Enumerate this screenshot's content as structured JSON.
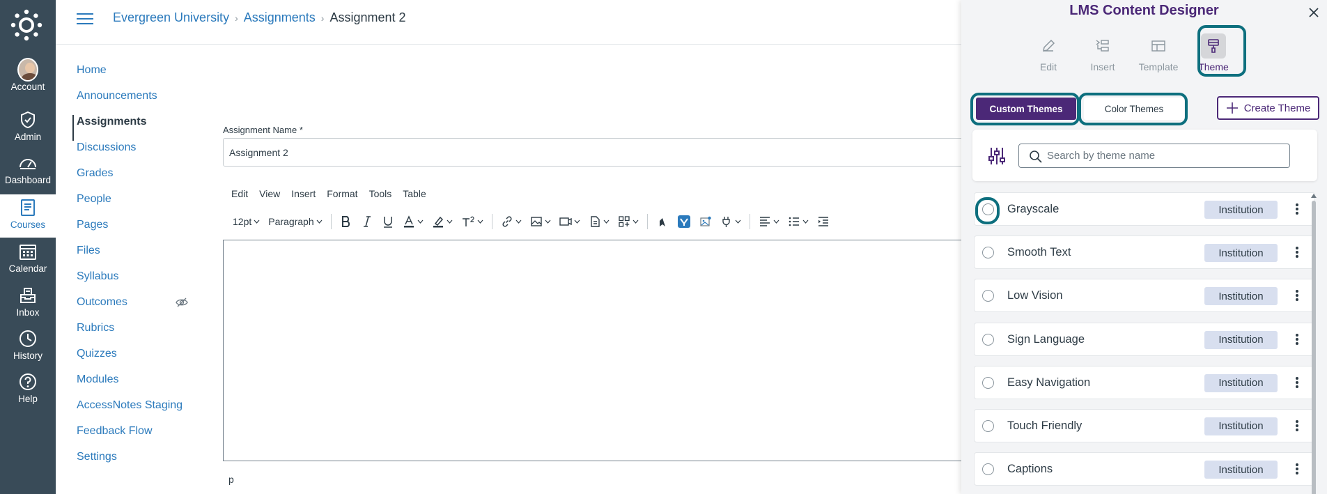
{
  "global_nav": {
    "items": [
      {
        "label": "Account",
        "icon": "avatar"
      },
      {
        "label": "Admin",
        "icon": "shield-icon"
      },
      {
        "label": "Dashboard",
        "icon": "dashboard-icon"
      },
      {
        "label": "Courses",
        "icon": "book-icon",
        "active": true
      },
      {
        "label": "Calendar",
        "icon": "calendar-icon"
      },
      {
        "label": "Inbox",
        "icon": "inbox-icon"
      },
      {
        "label": "History",
        "icon": "clock-icon"
      },
      {
        "label": "Help",
        "icon": "help-icon"
      }
    ]
  },
  "breadcrumb": {
    "items": [
      "Evergreen University",
      "Assignments"
    ],
    "current": "Assignment 2"
  },
  "course_nav": {
    "items": [
      {
        "label": "Home"
      },
      {
        "label": "Announcements"
      },
      {
        "label": "Assignments",
        "active": true
      },
      {
        "label": "Discussions"
      },
      {
        "label": "Grades"
      },
      {
        "label": "People"
      },
      {
        "label": "Pages"
      },
      {
        "label": "Files"
      },
      {
        "label": "Syllabus"
      },
      {
        "label": "Outcomes",
        "hidden_icon": "eye-slash-icon"
      },
      {
        "label": "Rubrics"
      },
      {
        "label": "Quizzes"
      },
      {
        "label": "Modules"
      },
      {
        "label": "AccessNotes Staging"
      },
      {
        "label": "Feedback Flow"
      },
      {
        "label": "Settings"
      }
    ]
  },
  "assignment": {
    "name_label": "Assignment Name *",
    "name_value": "Assignment 2"
  },
  "editor": {
    "menu": [
      "Edit",
      "View",
      "Insert",
      "Format",
      "Tools",
      "Table"
    ],
    "font_size": "12pt",
    "block_format": "Paragraph",
    "status_path": "p"
  },
  "panel": {
    "title": "LMS Content Designer",
    "tabs": [
      {
        "label": "Edit",
        "icon": "pencil-icon"
      },
      {
        "label": "Insert",
        "icon": "insert-icon"
      },
      {
        "label": "Template",
        "icon": "template-icon"
      },
      {
        "label": "Theme",
        "icon": "paint-roller-icon",
        "active": true
      }
    ],
    "custom_themes_label": "Custom Themes",
    "color_themes_label": "Color Themes",
    "create_theme_label": "Create Theme",
    "search_placeholder": "Search by theme name",
    "themes": [
      {
        "name": "Grayscale",
        "badge": "Institution"
      },
      {
        "name": "Smooth Text",
        "badge": "Institution"
      },
      {
        "name": "Low Vision",
        "badge": "Institution"
      },
      {
        "name": "Sign Language",
        "badge": "Institution"
      },
      {
        "name": "Easy Navigation",
        "badge": "Institution"
      },
      {
        "name": "Touch Friendly",
        "badge": "Institution"
      },
      {
        "name": "Captions",
        "badge": "Institution"
      }
    ]
  },
  "colors": {
    "nav_bg": "#394b58",
    "link": "#2b7abc",
    "brand_purple": "#4b2877",
    "focus_teal": "#0d6f7e",
    "badge_bg": "#d8dfef"
  }
}
